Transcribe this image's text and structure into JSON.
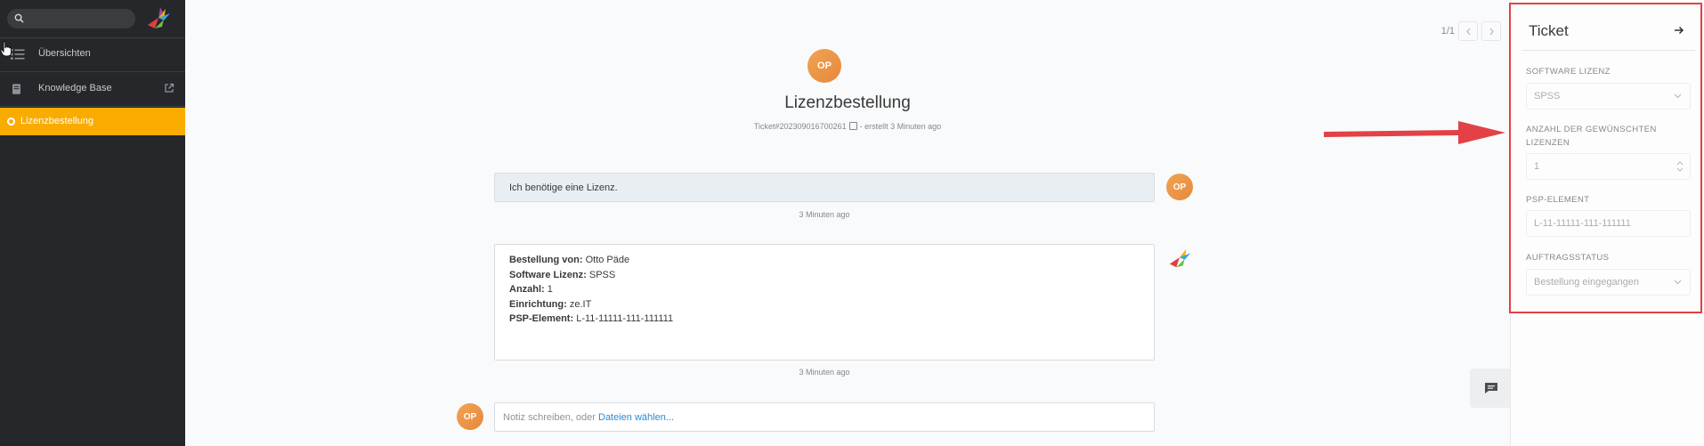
{
  "sidebar": {
    "search": {
      "placeholder": "",
      "value": ""
    },
    "items": [
      {
        "label": "Übersichten",
        "icon": "list-icon"
      },
      {
        "label": "Knowledge Base",
        "icon": "book-icon",
        "external": true
      }
    ],
    "active_ticket": {
      "label": "Lizenzbestellung"
    }
  },
  "pager": {
    "text": "1/1"
  },
  "ticket": {
    "avatar_initials": "OP",
    "title": "Lizenzbestellung",
    "number": "Ticket#2023090167002​61",
    "created": "- erstellt 3 Minuten ago"
  },
  "articles": [
    {
      "text": "Ich benötige eine Lizenz.",
      "time": "3 Minuten ago",
      "author_initials": "OP"
    },
    {
      "lines": [
        {
          "key": "Bestellung von:",
          "value": "Otto Päde"
        },
        {
          "key": "Software Lizenz:",
          "value": "SPSS"
        },
        {
          "key": "Anzahl:",
          "value": "1"
        },
        {
          "key": "Einrichtung:",
          "value": "ze.IT"
        },
        {
          "key": "PSP-Element:",
          "value": "L-11-11111-111-111111"
        }
      ],
      "time": "3 Minuten ago"
    }
  ],
  "note": {
    "prefix": "Notiz schreiben, oder ",
    "link": "Dateien wählen...",
    "author_initials": "OP"
  },
  "panel": {
    "title": "Ticket",
    "fields": [
      {
        "label": "SOFTWARE LIZENZ",
        "value": "SPSS"
      },
      {
        "label": "ANZAHL DER GEWÜNSCHTEN LIZENZEN",
        "value": "1"
      },
      {
        "label": "PSP-ELEMENT",
        "value": "L-11-11111-111-111111"
      },
      {
        "label": "AUFTRAGSSTATUS",
        "value": "Bestellung eingegangen"
      }
    ]
  },
  "colors": {
    "active_nav": "#faab00",
    "avatar": "#e8873d",
    "annotation": "#e24146",
    "link": "#2a8ad3"
  }
}
